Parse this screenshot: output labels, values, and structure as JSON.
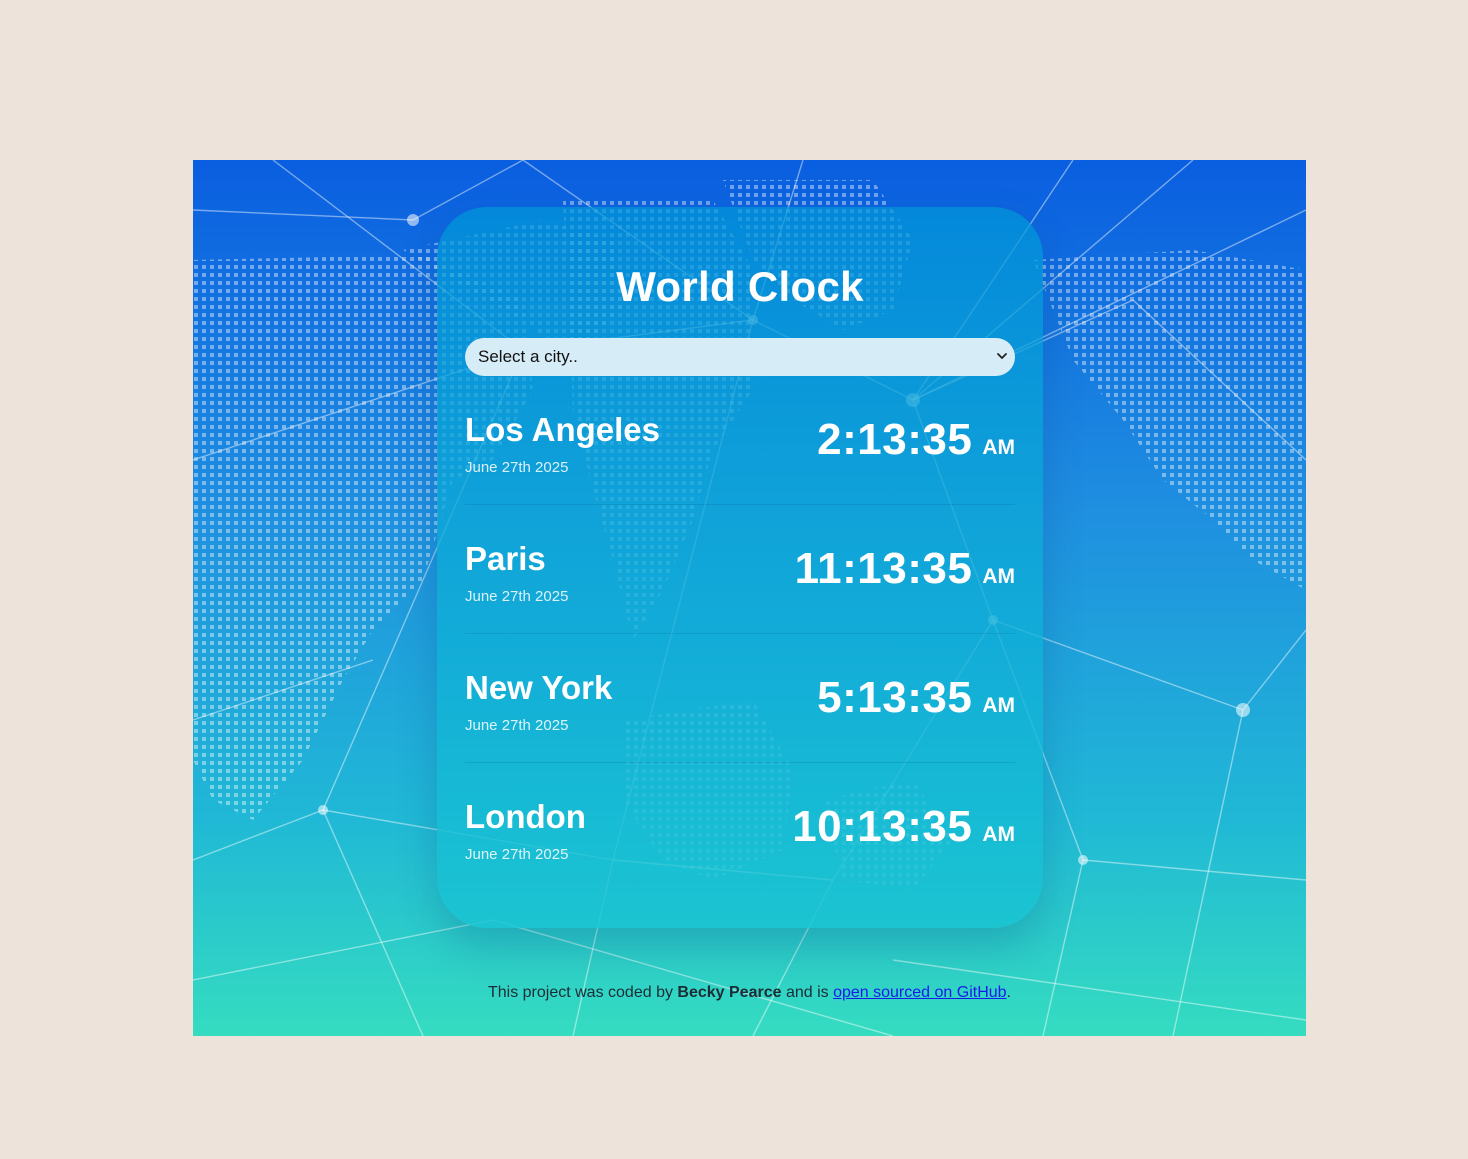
{
  "app": {
    "title": "World Clock",
    "select": {
      "placeholder": "Select a city..",
      "icon": "chevron-down-icon"
    },
    "cities": [
      {
        "name": "Los Angeles",
        "date": "June 27th 2025",
        "time": "2:13:35",
        "ampm": "AM"
      },
      {
        "name": "Paris",
        "date": "June 27th 2025",
        "time": "11:13:35",
        "ampm": "AM"
      },
      {
        "name": "New York",
        "date": "June 27th 2025",
        "time": "5:13:35",
        "ampm": "AM"
      },
      {
        "name": "London",
        "date": "June 27th 2025",
        "time": "10:13:35",
        "ampm": "AM"
      }
    ]
  },
  "footer": {
    "prefix": "This project was coded by ",
    "author": "Becky Pearce",
    "middle": " and is ",
    "link_text": "open sourced on GitHub",
    "suffix": "."
  },
  "colors": {
    "page_bg": "#ede3da",
    "gradient_top": "#0a5ee0",
    "gradient_bottom": "#35dcc0",
    "link": "#1a1ae8"
  }
}
